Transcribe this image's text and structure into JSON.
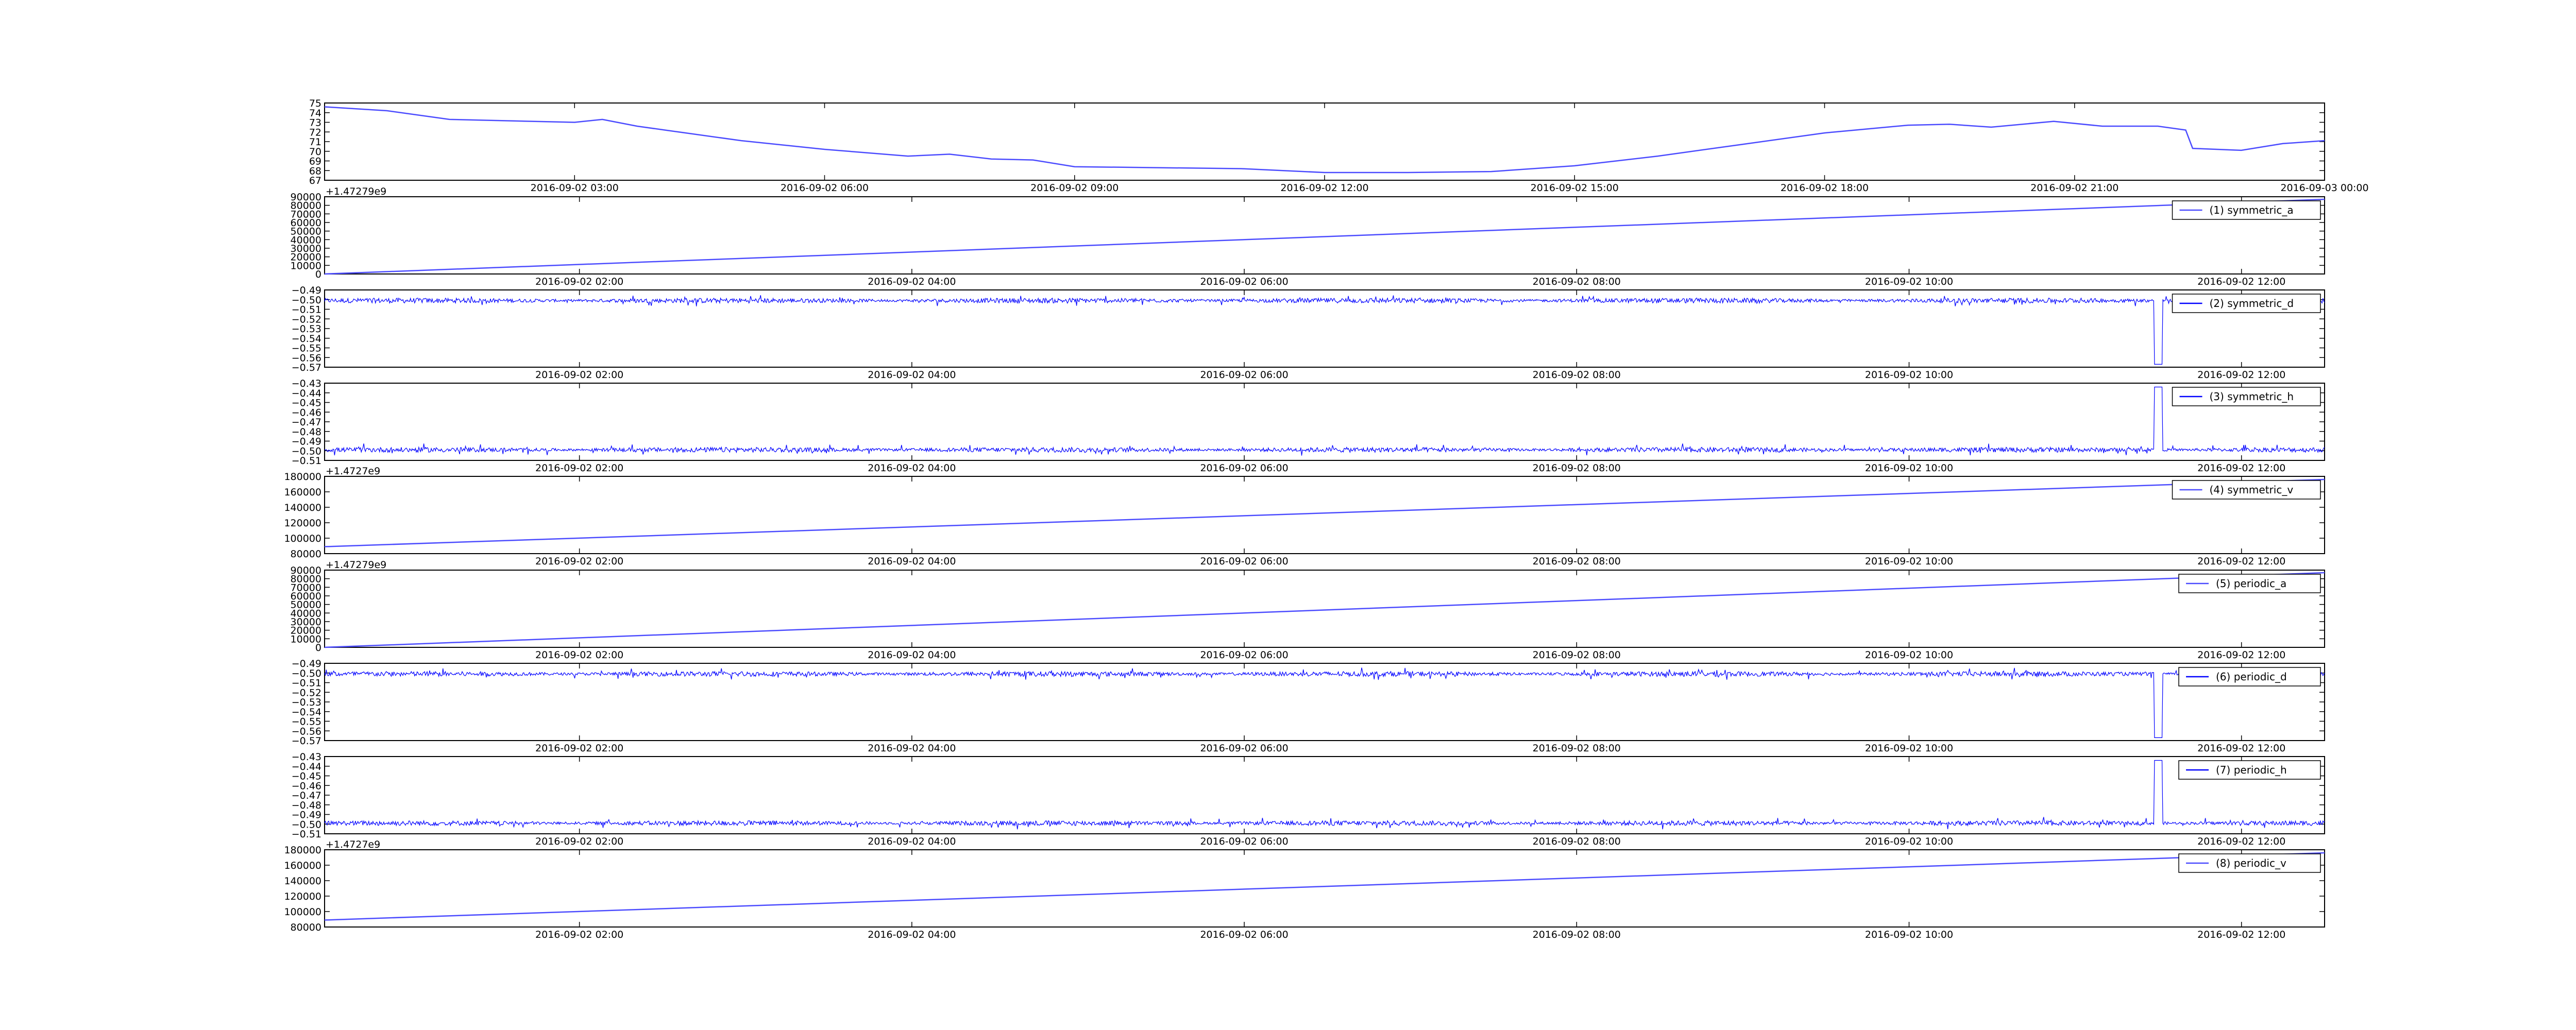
{
  "chart_data": [
    {
      "type": "line",
      "offset_text": "",
      "xticks": [
        "2016-09-02 03:00",
        "2016-09-02 06:00",
        "2016-09-02 09:00",
        "2016-09-02 12:00",
        "2016-09-02 15:00",
        "2016-09-02 18:00",
        "2016-09-02 21:00",
        "2016-09-03 00:00"
      ],
      "xlim": [
        "2016-09-02 00:00",
        "2016-09-03 00:00"
      ],
      "ylim": [
        67,
        75
      ],
      "yticks": [
        "75",
        "74",
        "73",
        "72",
        "71",
        "70",
        "69",
        "68",
        "67"
      ],
      "color": "#4b4bff",
      "series": [
        {
          "name": "",
          "x": [
            "2016-09-02 00:00",
            "2016-09-02 00:45",
            "2016-09-02 01:30",
            "2016-09-02 03:00",
            "2016-09-02 03:20",
            "2016-09-02 03:45",
            "2016-09-02 04:15",
            "2016-09-02 05:00",
            "2016-09-02 06:00",
            "2016-09-02 07:00",
            "2016-09-02 07:30",
            "2016-09-02 08:00",
            "2016-09-02 08:30",
            "2016-09-02 09:00",
            "2016-09-02 10:00",
            "2016-09-02 11:00",
            "2016-09-02 12:00",
            "2016-09-02 13:00",
            "2016-09-02 14:00",
            "2016-09-02 15:00",
            "2016-09-02 16:00",
            "2016-09-02 17:00",
            "2016-09-02 18:00",
            "2016-09-02 19:00",
            "2016-09-02 19:30",
            "2016-09-02 20:00",
            "2016-09-02 20:45",
            "2016-09-02 21:20",
            "2016-09-02 22:00",
            "2016-09-02 22:20",
            "2016-09-02 22:25",
            "2016-09-02 23:00",
            "2016-09-02 23:30",
            "2016-09-03 00:00"
          ],
          "values": [
            74.6,
            74.2,
            73.3,
            73.0,
            73.3,
            72.6,
            72.0,
            71.1,
            70.2,
            69.5,
            69.7,
            69.2,
            69.1,
            68.4,
            68.3,
            68.2,
            67.8,
            67.8,
            67.9,
            68.5,
            69.5,
            70.7,
            71.9,
            72.7,
            72.8,
            72.5,
            73.1,
            72.6,
            72.6,
            72.2,
            70.3,
            70.1,
            70.8,
            71.1
          ]
        }
      ]
    },
    {
      "type": "line",
      "offset_text": "+1.47279e9",
      "xticks": [
        "2016-09-02 02:00",
        "2016-09-02 04:00",
        "2016-09-02 06:00",
        "2016-09-02 08:00",
        "2016-09-02 10:00",
        "2016-09-02 12:00"
      ],
      "xlim": [
        "2016-09-02 00:28",
        "2016-09-02 12:30"
      ],
      "ylim": [
        0,
        90000
      ],
      "yticks": [
        "90000",
        "80000",
        "70000",
        "60000",
        "50000",
        "40000",
        "30000",
        "20000",
        "10000",
        "0"
      ],
      "color": "#4b4bff",
      "series": [
        {
          "name": "(1) symmetric_a",
          "x": [
            "2016-09-02 00:28",
            "2016-09-02 12:30"
          ],
          "values": [
            0,
            87000
          ]
        }
      ]
    },
    {
      "type": "line",
      "offset_text": "",
      "xticks": [
        "2016-09-02 02:00",
        "2016-09-02 04:00",
        "2016-09-02 06:00",
        "2016-09-02 08:00",
        "2016-09-02 10:00",
        "2016-09-02 12:00"
      ],
      "xlim": [
        "2016-09-02 00:28",
        "2016-09-02 12:30"
      ],
      "ylim": [
        -0.57,
        -0.49
      ],
      "yticks": [
        "−0.49",
        "−0.50",
        "−0.51",
        "−0.52",
        "−0.53",
        "−0.54",
        "−0.55",
        "−0.56",
        "−0.57"
      ],
      "color": "#0000ff",
      "baseline": -0.501,
      "spike": {
        "x": "2016-09-02 11:30",
        "value": -0.567
      },
      "series": [
        {
          "name": "(2) symmetric_d",
          "x": [
            "2016-09-02 00:28",
            "2016-09-02 12:30"
          ],
          "values": [
            -0.501,
            -0.501
          ]
        }
      ]
    },
    {
      "type": "line",
      "offset_text": "",
      "xticks": [
        "2016-09-02 02:00",
        "2016-09-02 04:00",
        "2016-09-02 06:00",
        "2016-09-02 08:00",
        "2016-09-02 10:00",
        "2016-09-02 12:00"
      ],
      "xlim": [
        "2016-09-02 00:28",
        "2016-09-02 12:30"
      ],
      "ylim": [
        -0.51,
        -0.43
      ],
      "yticks": [
        "−0.43",
        "−0.44",
        "−0.45",
        "−0.46",
        "−0.47",
        "−0.48",
        "−0.49",
        "−0.50",
        "−0.51"
      ],
      "color": "#0000ff",
      "baseline": -0.499,
      "spike": {
        "x": "2016-09-02 11:30",
        "value": -0.434
      },
      "series": [
        {
          "name": "(3) symmetric_h",
          "x": [
            "2016-09-02 00:28",
            "2016-09-02 12:30"
          ],
          "values": [
            -0.499,
            -0.499
          ]
        }
      ]
    },
    {
      "type": "line",
      "offset_text": "+1.4727e9",
      "xticks": [
        "2016-09-02 02:00",
        "2016-09-02 04:00",
        "2016-09-02 06:00",
        "2016-09-02 08:00",
        "2016-09-02 10:00",
        "2016-09-02 12:00"
      ],
      "xlim": [
        "2016-09-02 00:28",
        "2016-09-02 12:30"
      ],
      "ylim": [
        80000,
        180000
      ],
      "yticks": [
        "180000",
        "160000",
        "140000",
        "120000",
        "100000",
        "80000"
      ],
      "color": "#4b4bff",
      "series": [
        {
          "name": "(4) symmetric_v",
          "x": [
            "2016-09-02 00:28",
            "2016-09-02 12:30"
          ],
          "values": [
            89000,
            176000
          ]
        }
      ]
    },
    {
      "type": "line",
      "offset_text": "+1.47279e9",
      "xticks": [
        "2016-09-02 02:00",
        "2016-09-02 04:00",
        "2016-09-02 06:00",
        "2016-09-02 08:00",
        "2016-09-02 10:00",
        "2016-09-02 12:00"
      ],
      "xlim": [
        "2016-09-02 00:28",
        "2016-09-02 12:30"
      ],
      "ylim": [
        0,
        90000
      ],
      "yticks": [
        "90000",
        "80000",
        "70000",
        "60000",
        "50000",
        "40000",
        "30000",
        "20000",
        "10000",
        "0"
      ],
      "color": "#4b4bff",
      "series": [
        {
          "name": "(5) periodic_a",
          "x": [
            "2016-09-02 00:28",
            "2016-09-02 12:30"
          ],
          "values": [
            0,
            87000
          ]
        }
      ]
    },
    {
      "type": "line",
      "offset_text": "",
      "xticks": [
        "2016-09-02 02:00",
        "2016-09-02 04:00",
        "2016-09-02 06:00",
        "2016-09-02 08:00",
        "2016-09-02 10:00",
        "2016-09-02 12:00"
      ],
      "xlim": [
        "2016-09-02 00:28",
        "2016-09-02 12:30"
      ],
      "ylim": [
        -0.57,
        -0.49
      ],
      "yticks": [
        "−0.49",
        "−0.50",
        "−0.51",
        "−0.52",
        "−0.53",
        "−0.54",
        "−0.55",
        "−0.56",
        "−0.57"
      ],
      "color": "#0000ff",
      "baseline": -0.501,
      "spike": {
        "x": "2016-09-02 11:30",
        "value": -0.567
      },
      "series": [
        {
          "name": "(6) periodic_d",
          "x": [
            "2016-09-02 00:28",
            "2016-09-02 12:30"
          ],
          "values": [
            -0.501,
            -0.501
          ]
        }
      ]
    },
    {
      "type": "line",
      "offset_text": "",
      "xticks": [
        "2016-09-02 02:00",
        "2016-09-02 04:00",
        "2016-09-02 06:00",
        "2016-09-02 08:00",
        "2016-09-02 10:00",
        "2016-09-02 12:00"
      ],
      "xlim": [
        "2016-09-02 00:28",
        "2016-09-02 12:30"
      ],
      "ylim": [
        -0.51,
        -0.43
      ],
      "yticks": [
        "−0.43",
        "−0.44",
        "−0.45",
        "−0.46",
        "−0.47",
        "−0.48",
        "−0.49",
        "−0.50",
        "−0.51"
      ],
      "color": "#0000ff",
      "baseline": -0.499,
      "spike": {
        "x": "2016-09-02 11:30",
        "value": -0.434
      },
      "series": [
        {
          "name": "(7) periodic_h",
          "x": [
            "2016-09-02 00:28",
            "2016-09-02 12:30"
          ],
          "values": [
            -0.499,
            -0.499
          ]
        }
      ]
    },
    {
      "type": "line",
      "offset_text": "+1.4727e9",
      "xticks": [
        "2016-09-02 02:00",
        "2016-09-02 04:00",
        "2016-09-02 06:00",
        "2016-09-02 08:00",
        "2016-09-02 10:00",
        "2016-09-02 12:00"
      ],
      "xlim": [
        "2016-09-02 00:28",
        "2016-09-02 12:30"
      ],
      "ylim": [
        80000,
        180000
      ],
      "yticks": [
        "180000",
        "160000",
        "140000",
        "120000",
        "100000",
        "80000"
      ],
      "color": "#4b4bff",
      "series": [
        {
          "name": "(8) periodic_v",
          "x": [
            "2016-09-02 00:28",
            "2016-09-02 12:30"
          ],
          "values": [
            89000,
            176000
          ]
        }
      ]
    }
  ]
}
